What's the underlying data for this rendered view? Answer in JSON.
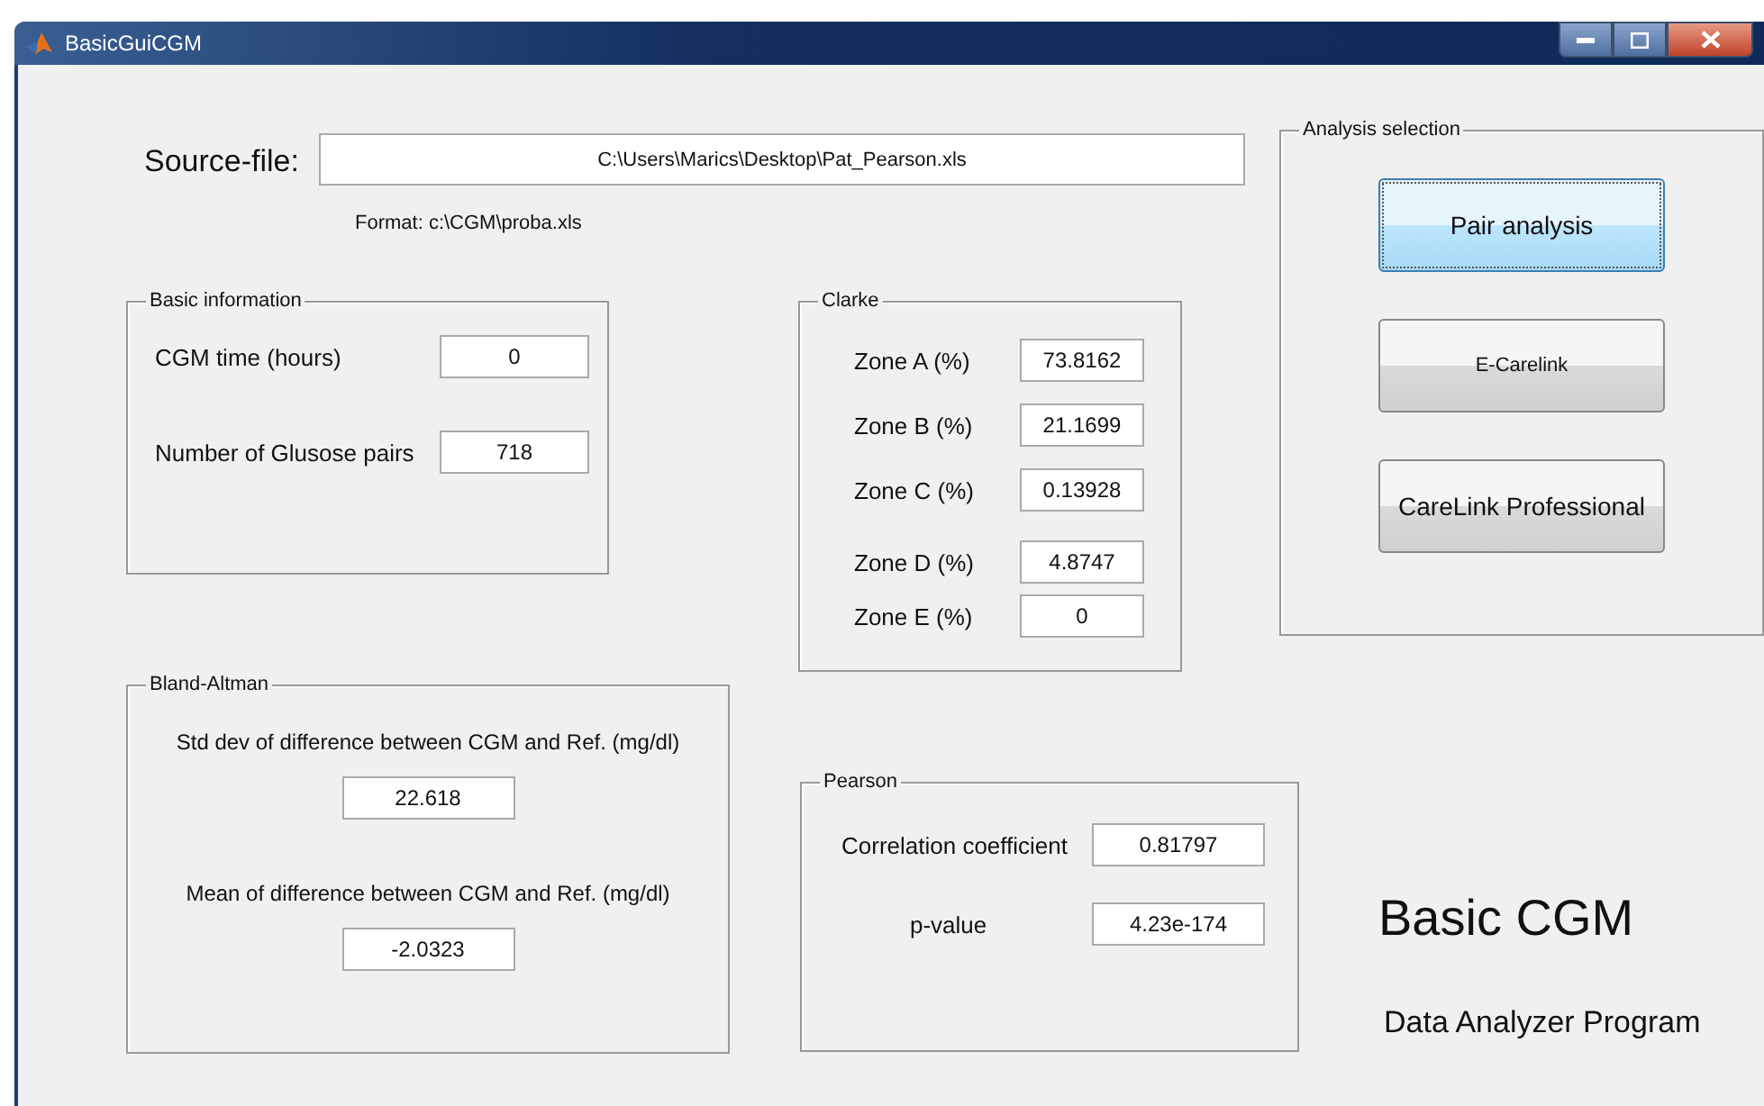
{
  "window": {
    "title": "BasicGuiCGM"
  },
  "source_file": {
    "label": "Source-file:",
    "value": "C:\\Users\\Marics\\Desktop\\Pat_Pearson.xls",
    "format_hint": "Format: c:\\CGM\\proba.xls"
  },
  "basic_information": {
    "title": "Basic information",
    "fields": [
      {
        "label": "CGM time (hours)",
        "value": "0"
      },
      {
        "label": "Number of Glusose pairs",
        "value": "718"
      }
    ]
  },
  "clarke": {
    "title": "Clarke",
    "fields": [
      {
        "label": "Zone A (%)",
        "value": "73.8162"
      },
      {
        "label": "Zone B (%)",
        "value": "21.1699"
      },
      {
        "label": "Zone C (%)",
        "value": "0.13928"
      },
      {
        "label": "Zone D (%)",
        "value": "4.8747"
      },
      {
        "label": "Zone E (%)",
        "value": "0"
      }
    ]
  },
  "bland_altman": {
    "title": "Bland-Altman",
    "fields": [
      {
        "label": "Std dev of difference between CGM and Ref. (mg/dl)",
        "value": "22.618"
      },
      {
        "label": "Mean of difference between CGM and Ref. (mg/dl)",
        "value": "-2.0323"
      }
    ]
  },
  "pearson": {
    "title": "Pearson",
    "fields": [
      {
        "label": "Correlation coefficient",
        "value": "0.81797"
      },
      {
        "label": "p-value",
        "value": "4.23e-174"
      }
    ]
  },
  "analysis_selection": {
    "title": "Analysis selection",
    "buttons": [
      {
        "label": "Pair analysis",
        "selected": true
      },
      {
        "label": "E-Carelink",
        "selected": false
      },
      {
        "label": "CareLink Professional",
        "selected": false
      }
    ]
  },
  "branding": {
    "title": "Basic CGM",
    "subtitle": "Data Analyzer Program"
  }
}
